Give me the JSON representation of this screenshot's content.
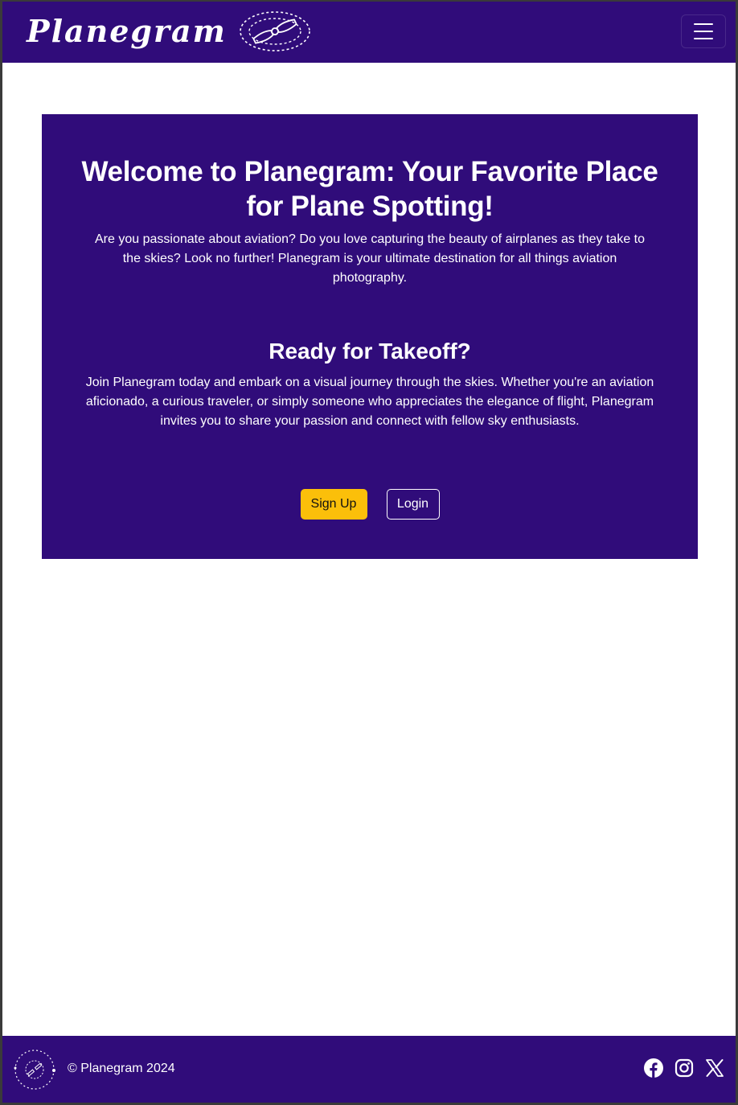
{
  "navbar": {
    "brand_text": "Planegram",
    "brand_icon": "propeller-logo-icon",
    "toggle_icon": "hamburger-menu-icon"
  },
  "hero": {
    "title": "Welcome to Planegram: Your Favorite Place for Plane Spotting!",
    "intro": "Are you passionate about aviation? Do you love capturing the beauty of airplanes as they take to the skies? Look no further! Planegram is your ultimate destination for all things aviation photography.",
    "subtitle": "Ready for Takeoff?",
    "join_text": "Join Planegram today and embark on a visual journey through the skies. Whether you're an aviation aficionado, a curious traveler, or simply someone who appreciates the elegance of flight, Planegram invites you to share your passion and connect with fellow sky enthusiasts.",
    "signup_label": "Sign Up",
    "login_label": "Login"
  },
  "footer": {
    "logo_text": "Planegram",
    "copyright": "© Planegram 2024",
    "social_icons": [
      "facebook-icon",
      "instagram-icon",
      "x-twitter-icon"
    ]
  },
  "colors": {
    "brand_purple": "#300c7a",
    "accent_yellow": "#fbbf0a",
    "page_bg": "#ffffff",
    "text_light": "#ffffff"
  }
}
